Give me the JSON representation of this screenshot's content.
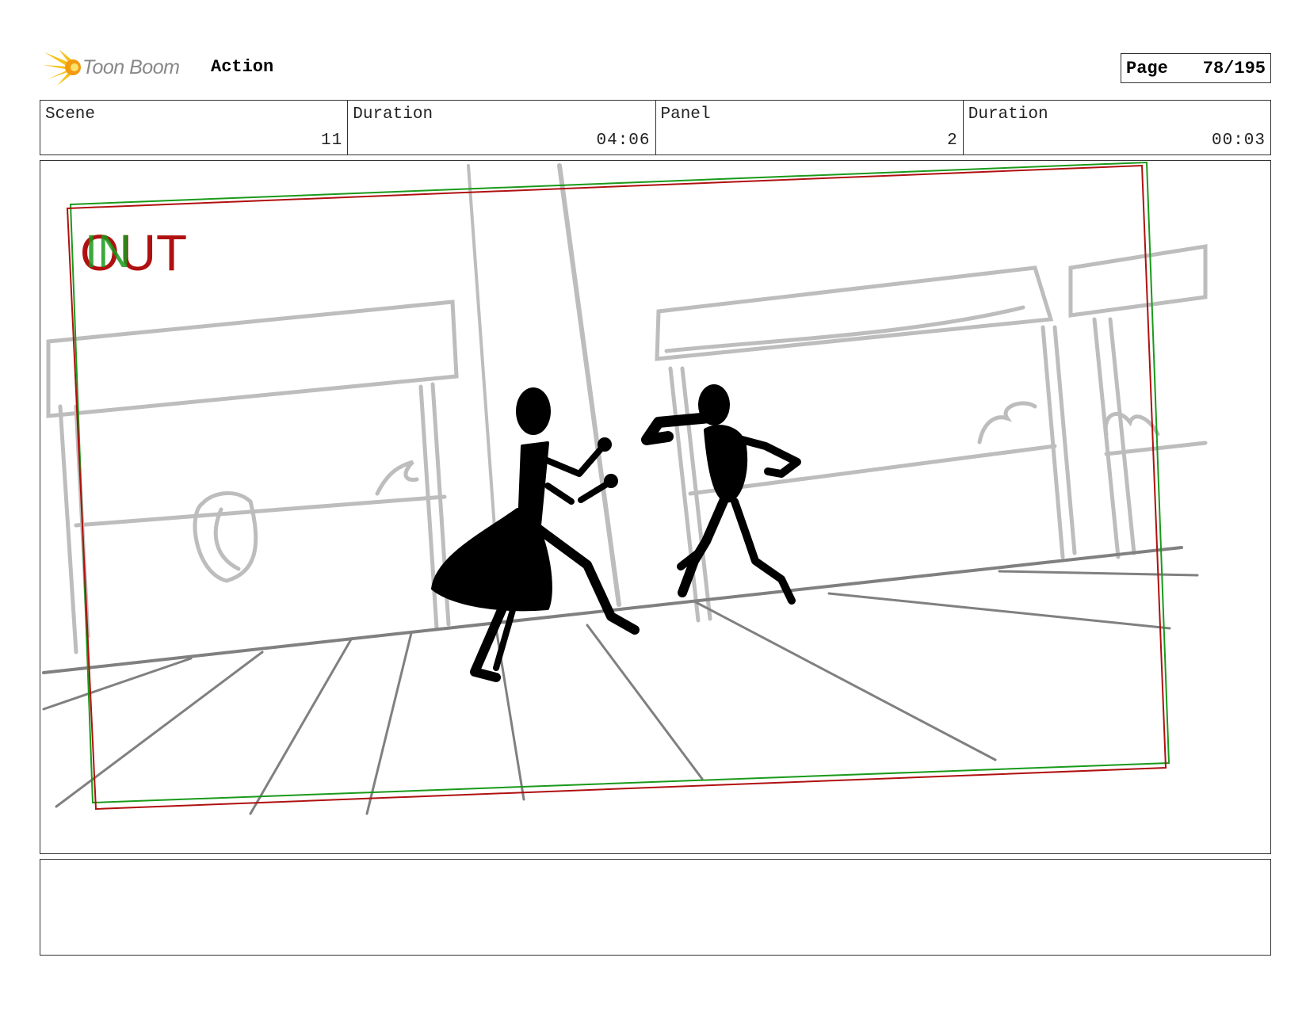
{
  "header": {
    "logo_text": "Toon Boom",
    "section_title": "Action",
    "page_label": "Page",
    "page_value": "78/195"
  },
  "info": [
    {
      "label": "Scene",
      "value": "11"
    },
    {
      "label": "Duration",
      "value": "04:06"
    },
    {
      "label": "Panel",
      "value": "2"
    },
    {
      "label": "Duration",
      "value": "00:03"
    }
  ],
  "panel": {
    "in_marker": "IN",
    "out_marker": "OUT",
    "colors": {
      "in": "#1a9a1a",
      "out": "#b01010",
      "sketch": "#bdbdbd",
      "floor": "#808080"
    }
  },
  "notes": {
    "text": ""
  },
  "icons": {
    "logo": "toon-boom-burst-icon"
  }
}
